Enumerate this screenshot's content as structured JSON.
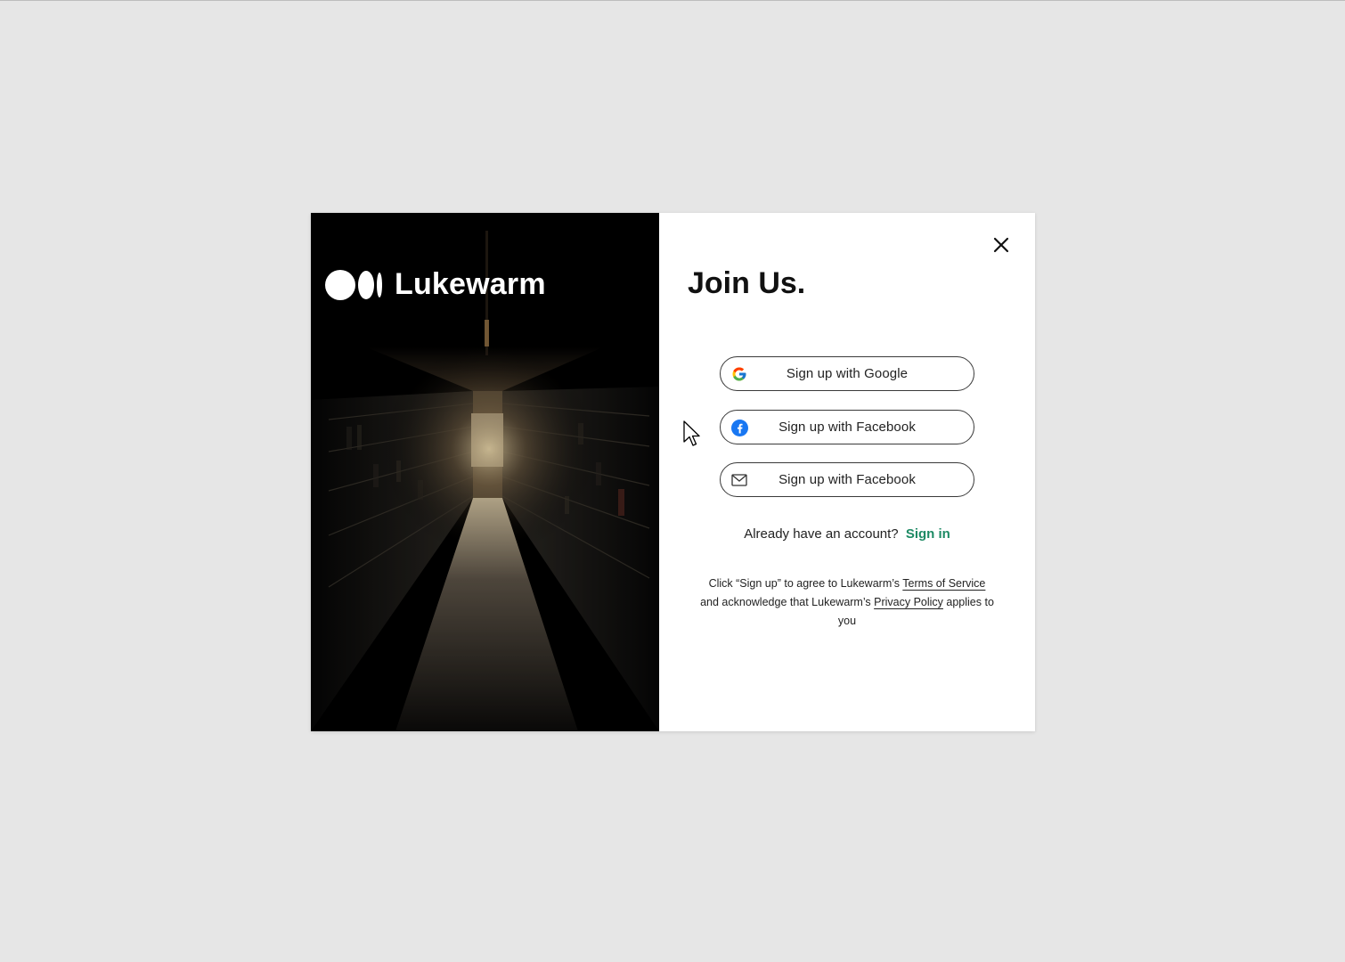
{
  "brand": {
    "name": "Lukewarm",
    "logo_icon": "lukewarm-logo-icon"
  },
  "hero": {
    "image": "library-aisle-photo"
  },
  "dialog": {
    "title": "Join Us.",
    "close_icon": "close-icon",
    "buttons": [
      {
        "label": "Sign up with Google",
        "icon": "google-icon"
      },
      {
        "label": "Sign up with Facebook",
        "icon": "facebook-icon"
      },
      {
        "label": "Sign up with Facebook",
        "icon": "mail-icon"
      }
    ],
    "signin": {
      "prompt": "Already have an account?",
      "link": "Sign in"
    },
    "legal": {
      "part1": "Click “Sign up” to agree to Lukewarm’s ",
      "terms": "Terms of Service",
      "part2": " and acknowledge that Lukewarm’s ",
      "privacy": "Privacy Policy",
      "part3": " applies to you"
    }
  },
  "colors": {
    "background": "#e6e6e6",
    "accent": "#1d8a64",
    "facebook": "#1877f2"
  }
}
